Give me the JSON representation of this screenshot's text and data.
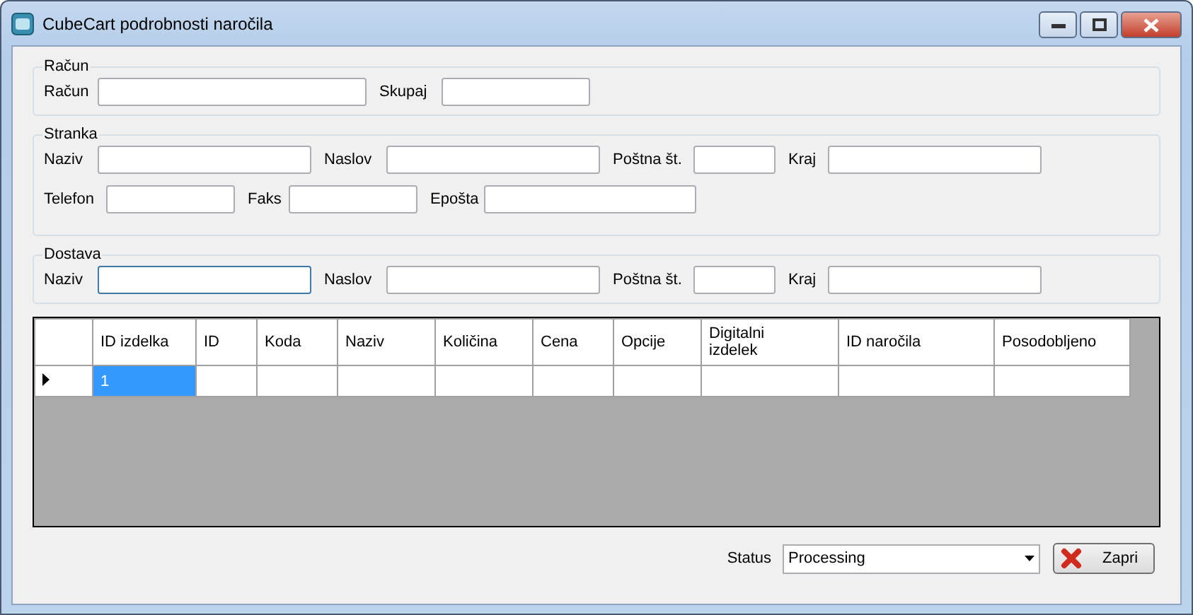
{
  "window": {
    "title": "CubeCart podrobnosti naročila"
  },
  "groups": [
    {
      "title": "Račun",
      "rows": [
        [
          {
            "label": "Račun",
            "focused": false
          },
          {
            "label": "Skupaj",
            "focused": false
          }
        ]
      ]
    },
    {
      "title": "Stranka",
      "rows": [
        [
          {
            "label": "Naziv",
            "focused": false
          },
          {
            "label": "Naslov",
            "focused": false
          },
          {
            "label": "Poštna št.",
            "focused": false
          },
          {
            "label": "Kraj",
            "focused": false
          }
        ],
        [
          {
            "label": "Telefon",
            "focused": false
          },
          {
            "label": "Faks",
            "focused": false
          },
          {
            "label": "Epošta",
            "focused": false
          }
        ]
      ]
    },
    {
      "title": "Dostava",
      "rows": [
        [
          {
            "label": "Naziv",
            "focused": true
          },
          {
            "label": "Naslov",
            "focused": false
          },
          {
            "label": "Poštna št.",
            "focused": false
          },
          {
            "label": "Kraj",
            "focused": false
          }
        ]
      ]
    }
  ],
  "table": {
    "columns": [
      "ID izdelka",
      "ID",
      "Koda",
      "Naziv",
      "Količina",
      "Cena",
      "Opcije",
      "Digitalni izdelek",
      "ID naročila",
      "Posodobljeno"
    ],
    "rows": [
      {
        "current": true,
        "cells": [
          {
            "value": "1",
            "selected": true
          },
          {
            "selected": false
          },
          {
            "selected": false
          },
          {
            "selected": false
          },
          {
            "selected": false
          },
          {
            "selected": false
          },
          {
            "selected": false
          },
          {
            "selected": false
          },
          {
            "selected": false
          },
          {
            "selected": false
          }
        ]
      }
    ]
  },
  "status": {
    "label": "Status",
    "value": "Processing"
  },
  "buttons": [
    {
      "label": "Zapri"
    }
  ]
}
